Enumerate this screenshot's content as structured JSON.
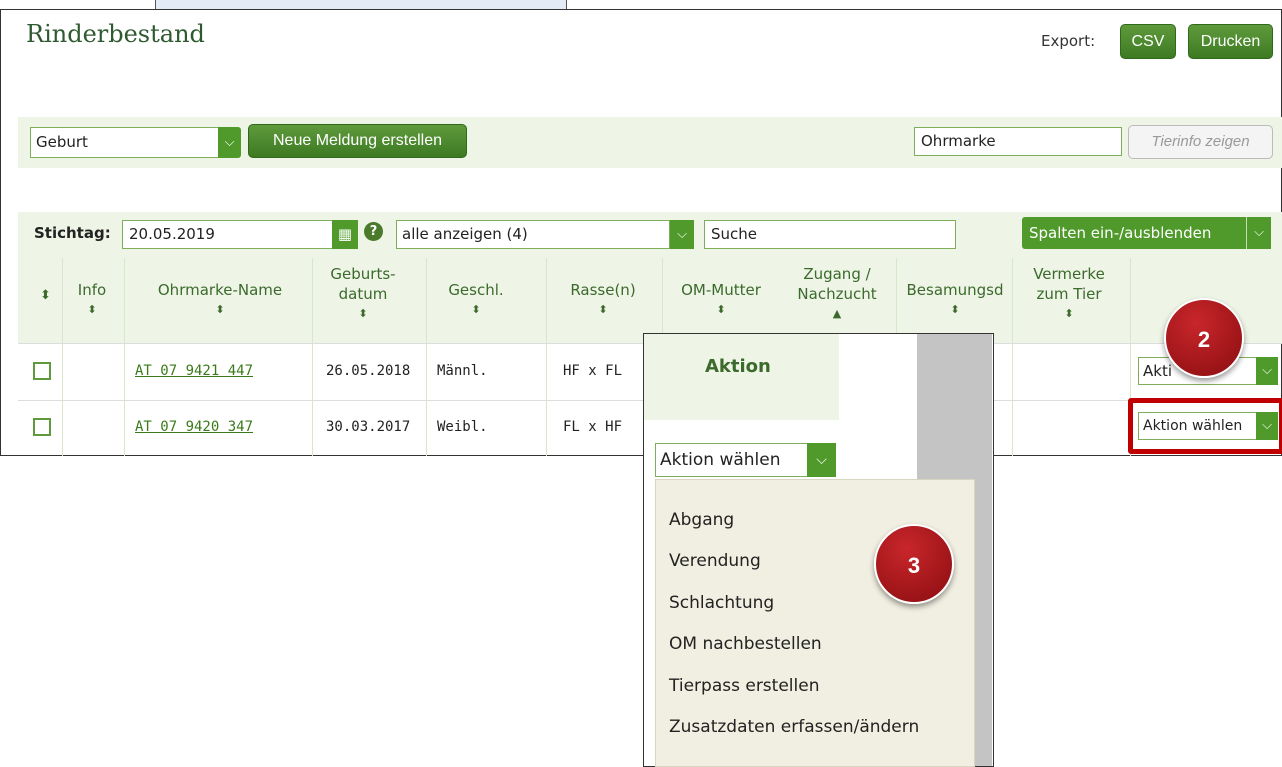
{
  "page": {
    "title": "Rinderbestand",
    "export_label": "Export:",
    "csv_label": "CSV",
    "print_label": "Drucken"
  },
  "toolbar": {
    "meldung_select": "Geburt",
    "new_report_label": "Neue Meldung erstellen",
    "ohrmarke_input_value": "Ohrmarke",
    "tierinfo_label": "Tierinfo zeigen"
  },
  "filter": {
    "stichtag_label": "Stichtag:",
    "stichtag_value": "20.05.2019",
    "show_select": "alle anzeigen (4)",
    "search_value": "Suche",
    "columns_button": "Spalten ein-/ausblenden"
  },
  "table": {
    "columns": [
      {
        "l1": "Info",
        "l2": ""
      },
      {
        "l1": "Ohrmarke-Name",
        "l2": ""
      },
      {
        "l1": "Geburts-",
        "l2": "datum"
      },
      {
        "l1": "Geschl.",
        "l2": ""
      },
      {
        "l1": "Rasse(n)",
        "l2": ""
      },
      {
        "l1": "OM-Mutter",
        "l2": ""
      },
      {
        "l1": "Zugang /",
        "l2": "Nachzucht"
      },
      {
        "l1": "Besamungsd",
        "l2": ""
      },
      {
        "l1": "Vermerke",
        "l2": "zum Tier"
      }
    ],
    "rows": [
      {
        "ohrmarke": "AT 07 9421 447",
        "geburtsdatum": "26.05.2018",
        "geschlecht": "Männl.",
        "rasse": "HF x FL",
        "aktion": "Aktion wählen"
      },
      {
        "ohrmarke": "AT 07 9420 347",
        "geburtsdatum": "30.03.2017",
        "geschlecht": "Weibl.",
        "rasse": "FL x HF",
        "aktion": "Aktion wählen"
      }
    ],
    "row1_aktion_partial": "Akti"
  },
  "dropdown": {
    "header": "Aktion",
    "select_value": "Aktion wählen",
    "items": [
      "Abgang",
      "Verendung",
      "Schlachtung",
      "OM nachbestellen",
      "Tierpass erstellen",
      "Zusatzdaten erfassen/ändern"
    ]
  },
  "badges": {
    "step2": "2",
    "step3": "3"
  },
  "colors": {
    "brand_green": "#3d7a22",
    "highlight_red": "#c00000",
    "badge_red": "#a01418"
  }
}
